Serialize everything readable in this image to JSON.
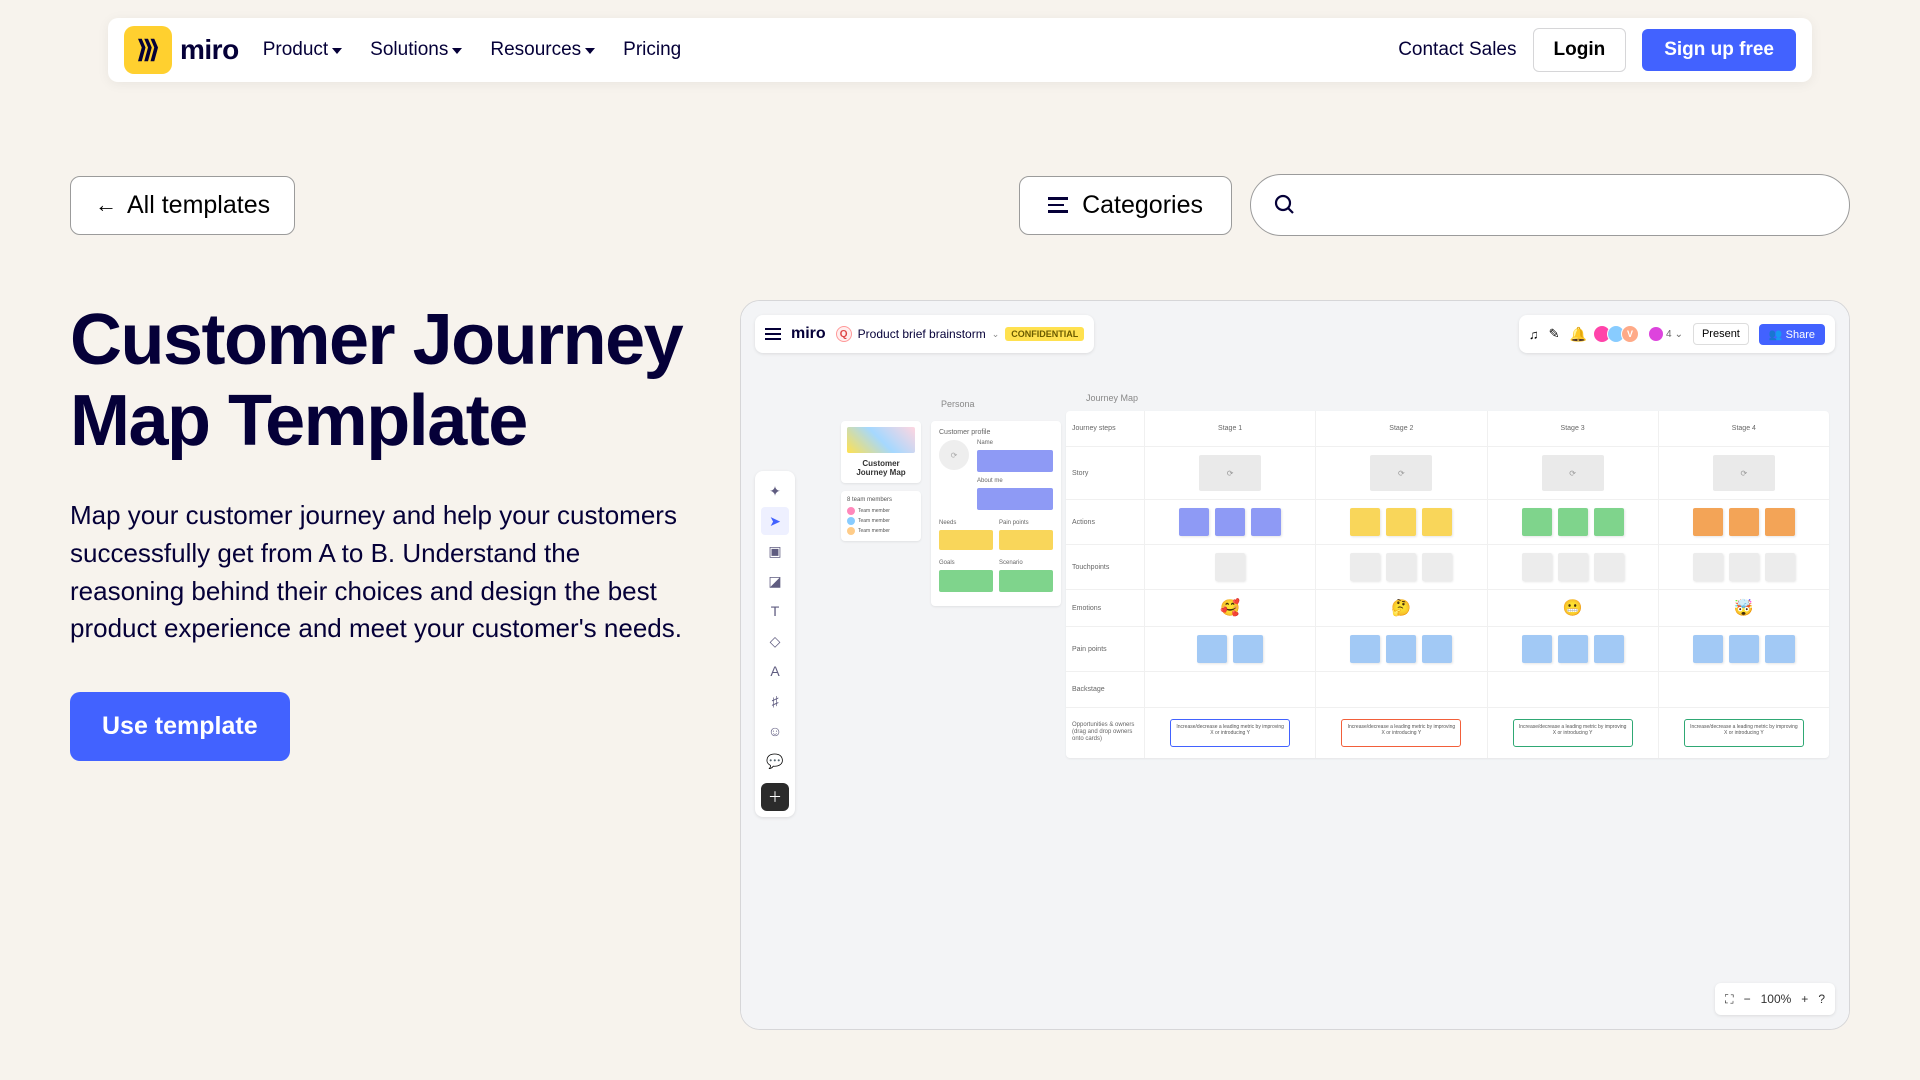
{
  "brand": "miro",
  "nav": {
    "items": [
      "Product",
      "Solutions",
      "Resources",
      "Pricing"
    ],
    "contact": "Contact Sales",
    "login": "Login",
    "signup": "Sign up free"
  },
  "secondary": {
    "all_templates": "All templates",
    "categories": "Categories",
    "search_placeholder": ""
  },
  "page": {
    "title": "Customer Journey Map Template",
    "description": "Map your customer journey and help your customers successfully get from A to B. Understand the reasoning behind their choices and design the best product experience and meet your customer's needs.",
    "use_template": "Use template"
  },
  "preview": {
    "board_name": "Product brief brainstorm",
    "confidential": "CONFIDENTIAL",
    "avatar_count": "4",
    "present": "Present",
    "share": "Share",
    "zoom": "100%",
    "persona_heading": "Persona",
    "journey_heading": "Journey Map",
    "persona_card_title": "Customer Journey Map",
    "profile_label": "Customer profile",
    "profile_sections": [
      "Name",
      "About me",
      "Needs",
      "Pain points",
      "Goals",
      "Scenario"
    ],
    "row_labels": [
      "Journey steps",
      "Story",
      "Actions",
      "Touchpoints",
      "Emotions",
      "Pain points",
      "Backstage",
      "Opportunities & owners (drag and drop owners onto cards)"
    ],
    "stages": [
      "Stage 1",
      "Stage 2",
      "Stage 3",
      "Stage 4"
    ],
    "emotions": [
      "🥰",
      "🤔",
      "😬",
      "🤯"
    ],
    "opportunity_text": "Increase/decrease a leading metric by improving X or introducing Y"
  }
}
